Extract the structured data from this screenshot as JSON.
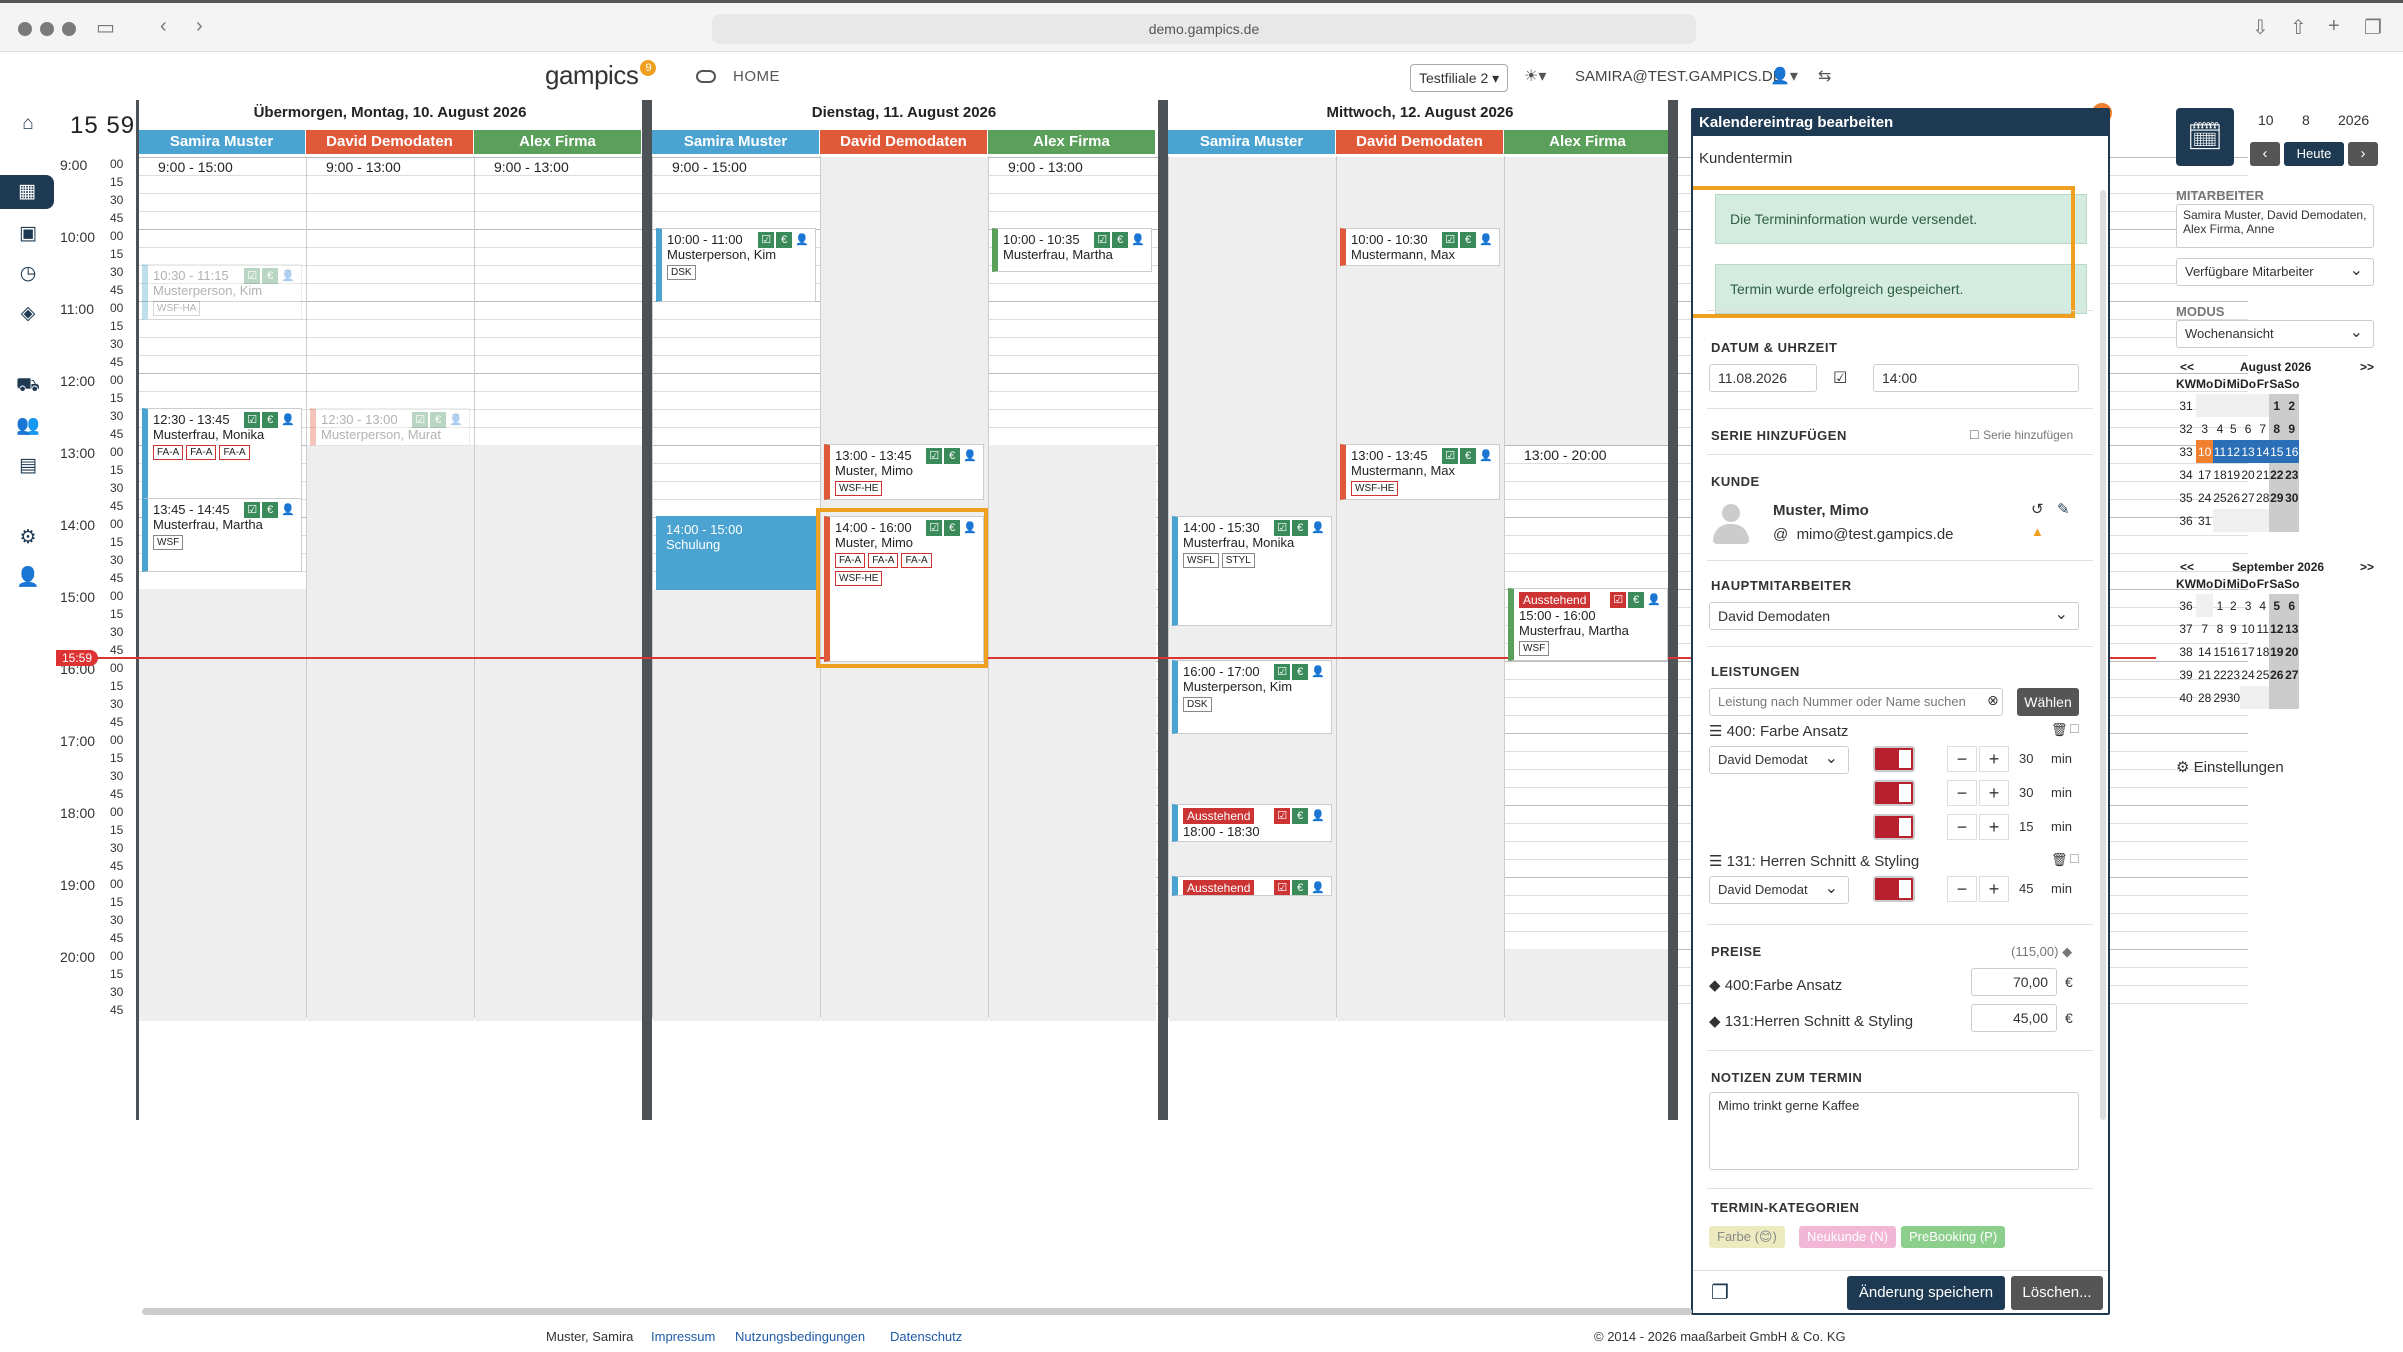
{
  "browser": {
    "url": "demo.gampics.de"
  },
  "app": {
    "logo": "gampics",
    "logo_badge": "9",
    "home": "HOME",
    "branch": "Testfiliale 2 ▾",
    "user": "SAMIRA@TEST.GAMPICS.DE",
    "clock": "15 59"
  },
  "times": [
    {
      "h": "9:00",
      "m": [
        "00",
        "15",
        "30",
        "45"
      ]
    },
    {
      "h": "10:00",
      "m": [
        "00",
        "15",
        "30",
        "45"
      ]
    },
    {
      "h": "11:00",
      "m": [
        "00",
        "15",
        "30",
        "45"
      ]
    },
    {
      "h": "12:00",
      "m": [
        "00",
        "15",
        "30",
        "45"
      ]
    },
    {
      "h": "13:00",
      "m": [
        "00",
        "15",
        "30",
        "45"
      ]
    },
    {
      "h": "14:00",
      "m": [
        "00",
        "15",
        "30",
        "45"
      ]
    },
    {
      "h": "15:00",
      "m": [
        "00",
        "15",
        "30",
        "45"
      ]
    },
    {
      "h": "16:00",
      "m": [
        "00",
        "15",
        "30",
        "45"
      ]
    },
    {
      "h": "17:00",
      "m": [
        "00",
        "15",
        "30",
        "45"
      ]
    },
    {
      "h": "18:00",
      "m": [
        "00",
        "15",
        "30",
        "45"
      ]
    },
    {
      "h": "19:00",
      "m": [
        "00",
        "15",
        "30",
        "45"
      ]
    },
    {
      "h": "20:00",
      "m": [
        "00",
        "15",
        "30",
        "45"
      ]
    }
  ],
  "now_tag": "15:59",
  "days": [
    {
      "title": "Übermorgen, Montag, 10. August 2026"
    },
    {
      "title": "Dienstag, 11. August 2026"
    },
    {
      "title": "Mittwoch, 12. August 2026"
    }
  ],
  "staff": [
    "Samira Muster",
    "David Demodaten",
    "Alex Firma"
  ],
  "staff_colors": [
    "#4aa3d0",
    "#e05a3a",
    "#5aa05a"
  ],
  "availability": [
    "9:00 - 15:00",
    "9:00 - 13:00",
    "9:00 - 13:00",
    "9:00 - 15:00",
    "9:00 - 13:00",
    "13:00 - 20:00"
  ],
  "events": {
    "e1": {
      "time": "10:30 - 11:15",
      "name": "Musterperson, Kim",
      "tag": "WSF-HA"
    },
    "e2": {
      "time": "12:30 - 13:45",
      "name": "Musterfrau, Monika",
      "tags": [
        "FA-A",
        "FA-A",
        "FA-A"
      ]
    },
    "e3": {
      "time": "13:45 - 14:45",
      "name": "Musterfrau, Martha",
      "tag": "WSF"
    },
    "e4": {
      "time": "12:30 - 13:00",
      "name": "Musterperson, Murat"
    },
    "e5": {
      "time": "10:00 - 11:00",
      "name": "Musterperson, Kim",
      "tag": "DSK"
    },
    "e6": {
      "time": "14:00 - 15:00",
      "name": "Schulung"
    },
    "e7": {
      "time": "13:00 - 13:45",
      "name": "Muster, Mimo",
      "tag": "WSF-HE"
    },
    "e8": {
      "time": "14:00 - 16:00",
      "name": "Muster, Mimo",
      "tags": [
        "FA-A",
        "FA-A",
        "FA-A"
      ],
      "tag2": "WSF-HE"
    },
    "e9": {
      "time": "10:00 - 10:35",
      "name": "Musterfrau, Martha"
    },
    "e10": {
      "time": "14:00 - 15:30",
      "name": "Musterfrau, Monika",
      "tags": [
        "WSFL",
        "STYL"
      ]
    },
    "e11": {
      "time": "16:00 - 17:00",
      "name": "Musterperson, Kim",
      "tag": "DSK"
    },
    "e12": {
      "pending": "Ausstehend",
      "time": "18:00 - 18:30"
    },
    "e13": {
      "pending": "Ausstehend"
    },
    "e14": {
      "time": "10:00 - 10:30",
      "name": "Mustermann, Max"
    },
    "e15": {
      "time": "13:00 - 13:45",
      "name": "Mustermann, Max",
      "tag": "WSF-HE"
    },
    "e16": {
      "pending": "Ausstehend",
      "time": "15:00 - 16:00",
      "name": "Musterfrau, Martha",
      "tag": "WSF"
    }
  },
  "panel": {
    "title": "Kalendereintrag bearbeiten",
    "subtitle": "Kundentermin",
    "alert1": "Die Termininformation wurde versendet.",
    "alert2": "Termin wurde erfolgreich gespeichert.",
    "date_label": "DATUM & UHRZEIT",
    "date": "11.08.2026",
    "time": "14:00",
    "series_label": "SERIE HINZUFÜGEN",
    "series_check": "Serie hinzufügen",
    "customer_label": "KUNDE",
    "customer_name": "Muster, Mimo",
    "customer_email": "mimo@test.gampics.de",
    "main_staff_label": "HAUPTMITARBEITER",
    "main_staff": "David Demodaten",
    "services_label": "LEISTUNGEN",
    "service_placeholder": "Leistung nach Nummer oder Name suchen",
    "choose": "Wählen",
    "service1": "400: Farbe Ansatz",
    "service1_staff": "David Demodat",
    "s1_rows": [
      "30",
      "30",
      "15"
    ],
    "service2": "131: Herren Schnitt & Styling",
    "service2_staff": "David Demodat",
    "s2_rows": [
      "45"
    ],
    "unit": "min",
    "prices_label": "PREISE",
    "prices_total": "(115,00)",
    "price1_label": "400:Farbe Ansatz",
    "price1": "70,00",
    "price2_label": "131:Herren Schnitt & Styling",
    "price2": "45,00",
    "currency": "€",
    "notes_label": "NOTIZEN ZUM TERMIN",
    "notes": "Mimo trinkt gerne Kaffee",
    "cats_label": "TERMIN-KATEGORIEN",
    "cats": [
      "Farbe (😊)",
      "Neukunde (N)",
      "PreBooking (P)"
    ],
    "save": "Änderung speichern",
    "delete": "Löschen..."
  },
  "right": {
    "date": [
      "10",
      "8",
      "2026"
    ],
    "today": "Heute",
    "staff_label": "MITARBEITER",
    "staff_value": "Samira Muster, David Demodaten, Alex Firma, Anne",
    "avail": "Verfügbare Mitarbeiter",
    "mode_label": "MODUS",
    "mode": "Wochenansicht",
    "aug_title": "August 2026",
    "sep_title": "September 2026",
    "weekdays": [
      "KW",
      "Mo",
      "Di",
      "Mi",
      "Do",
      "Fr",
      "Sa",
      "So"
    ],
    "aug": [
      [
        "31",
        "",
        "",
        "",
        "",
        "",
        "1",
        "2"
      ],
      [
        "32",
        "3",
        "4",
        "5",
        "6",
        "7",
        "8",
        "9"
      ],
      [
        "33",
        "10",
        "11",
        "12",
        "13",
        "14",
        "15",
        "16"
      ],
      [
        "34",
        "17",
        "18",
        "19",
        "20",
        "21",
        "22",
        "23"
      ],
      [
        "35",
        "24",
        "25",
        "26",
        "27",
        "28",
        "29",
        "30"
      ],
      [
        "36",
        "31",
        "",
        "",
        "",
        "",
        "",
        ""
      ]
    ],
    "sep": [
      [
        "36",
        "",
        "1",
        "2",
        "3",
        "4",
        "5",
        "6"
      ],
      [
        "37",
        "7",
        "8",
        "9",
        "10",
        "11",
        "12",
        "13"
      ],
      [
        "38",
        "14",
        "15",
        "16",
        "17",
        "18",
        "19",
        "20"
      ],
      [
        "39",
        "21",
        "22",
        "23",
        "24",
        "25",
        "26",
        "27"
      ],
      [
        "40",
        "28",
        "29",
        "30",
        "",
        "",
        "",
        ""
      ]
    ],
    "settings": "Einstellungen"
  },
  "footer": {
    "user": "Muster, Samira",
    "impressum": "Impressum",
    "terms": "Nutzungsbedingungen",
    "privacy": "Datenschutz",
    "copyright": "© 2014 - 2026 maaßarbeit GmbH & Co. KG"
  }
}
